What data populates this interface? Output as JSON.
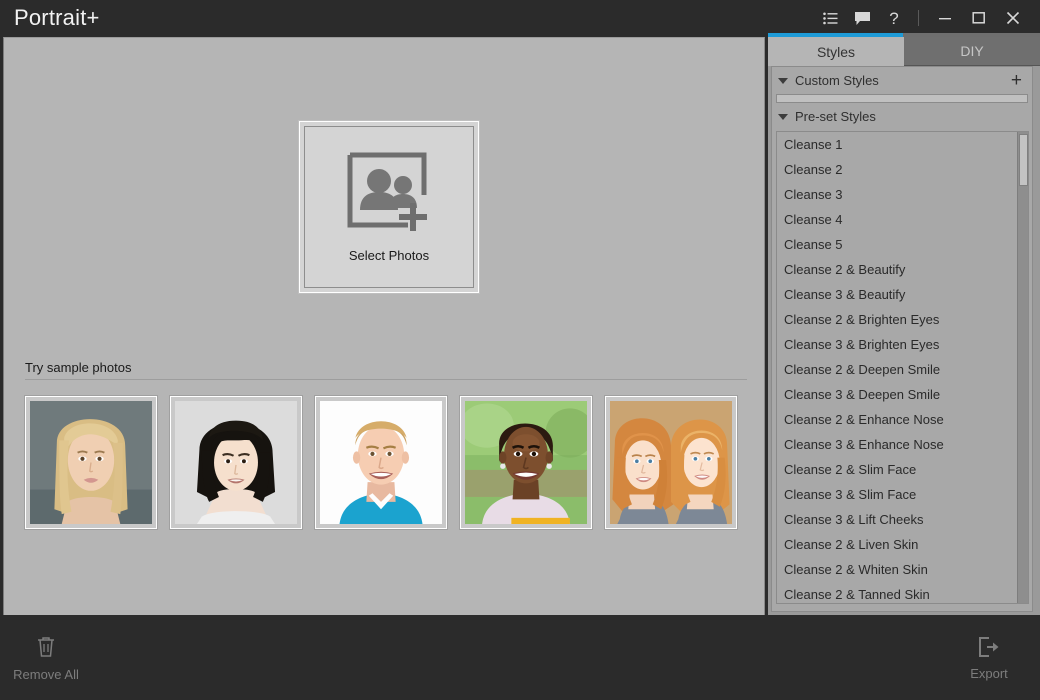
{
  "titlebar": {
    "app_title": "Portrait+",
    "icons": [
      {
        "name": "list-icon",
        "glyph": "list"
      },
      {
        "name": "feedback-icon",
        "glyph": "speech-bubble"
      },
      {
        "name": "help-icon",
        "glyph": "?"
      }
    ],
    "window_controls": [
      {
        "name": "minimize-button",
        "glyph": "minimize"
      },
      {
        "name": "maximize-button",
        "glyph": "maximize"
      },
      {
        "name": "close-button",
        "glyph": "close"
      }
    ]
  },
  "canvas": {
    "dropzone": {
      "label": "Select Photos",
      "icon": "add-photos-icon"
    },
    "samples": {
      "title": "Try sample photos",
      "thumbnails": [
        {
          "name": "sample-photo-1",
          "alt": "blonde woman portrait"
        },
        {
          "name": "sample-photo-2",
          "alt": "asian woman portrait"
        },
        {
          "name": "sample-photo-3",
          "alt": "young man in blue shirt portrait"
        },
        {
          "name": "sample-photo-4",
          "alt": "smiling girl outdoors portrait"
        },
        {
          "name": "sample-photo-5",
          "alt": "two red-haired girls portrait"
        }
      ]
    }
  },
  "right_panel": {
    "tabs": [
      {
        "label": "Styles",
        "active": true
      },
      {
        "label": "DIY",
        "active": false
      }
    ],
    "custom_styles": {
      "label": "Custom Styles",
      "add_label": "+",
      "items": []
    },
    "preset_styles": {
      "label": "Pre-set Styles",
      "items": [
        "Cleanse 1",
        "Cleanse 2",
        "Cleanse 3",
        "Cleanse 4",
        "Cleanse 5",
        "Cleanse 2 & Beautify",
        "Cleanse 3 & Beautify",
        "Cleanse 2 & Brighten Eyes",
        "Cleanse 3 & Brighten Eyes",
        "Cleanse 2 & Deepen Smile",
        "Cleanse 3 & Deepen Smile",
        "Cleanse 2 & Enhance Nose",
        "Cleanse 3 & Enhance Nose",
        "Cleanse 2 & Slim Face",
        "Cleanse 3 & Slim Face",
        "Cleanse 3 & Lift Cheeks",
        "Cleanse 2 & Liven Skin",
        "Cleanse 2 & Whiten Skin",
        "Cleanse 2 & Tanned Skin"
      ]
    }
  },
  "bottom_bar": {
    "remove_all_label": "Remove All",
    "export_label": "Export"
  },
  "colors": {
    "accent": "#1e9bd7",
    "titlebar_bg": "#2b2b2b",
    "canvas_bg": "#b5b5b5",
    "panel_bg": "#a8a8a8",
    "tab_inactive_bg": "#6f6f6f",
    "disabled_text": "#7d7d7d"
  }
}
